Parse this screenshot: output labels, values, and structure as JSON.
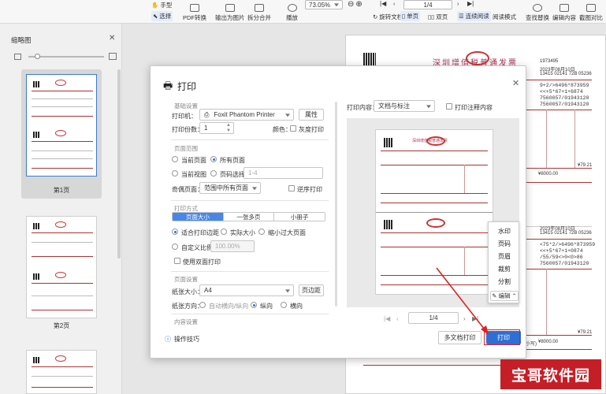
{
  "toolbar": {
    "hand_label": "手型",
    "select_label": "选择",
    "pdf_convert": "PDF转换",
    "export_image": "输出为图片",
    "split_merge": "拆分合并",
    "play": "播放",
    "zoom": "73.05%",
    "page_indicator": "1/4",
    "rotate": "旋转文档",
    "single_page": "单页",
    "double_page": "双页",
    "continuous": "连续阅读",
    "read_mode": "阅读模式",
    "find_replace": "查找替换",
    "edit_content": "编辑内容",
    "screenshot": "截图对比"
  },
  "sidebar": {
    "title": "缩略图",
    "pages": [
      "第1页",
      "第2页"
    ]
  },
  "dialog": {
    "title": "打印",
    "basic_settings": "基础设置",
    "printer_label": "打印机：",
    "printer_value": "Foxit Phantom Printer",
    "properties_button": "属性",
    "copies_label": "打印份数：",
    "copies_value": "1",
    "color_label": "颜色：",
    "grayscale_label": "灰度打印",
    "page_range": "页面范围",
    "current_page": "当前页面",
    "all_pages": "所有页面",
    "current_view": "当前视图",
    "page_select": "页码选择：",
    "page_select_placeholder": "1-4",
    "odd_even_label": "奇偶页面：",
    "odd_even_value": "范围中所有页面",
    "reverse_print": "逆序打印",
    "print_mode": "打印方式",
    "mode_tabs": [
      "页面大小",
      "一张多页",
      "小册子"
    ],
    "fit_margin": "适合打印边距",
    "actual_size": "实际大小",
    "shrink_large": "缩小过大页面",
    "custom_scale": "自定义比例",
    "custom_scale_value": "100.00%",
    "duplex": "使用双面打印",
    "page_setup": "页面设置",
    "paper_size_label": "纸张大小：",
    "paper_size_value": "A4",
    "page_margin_button": "页边距",
    "orientation_label": "纸张方向：",
    "orient_auto": "自动横向/纵向",
    "orient_portrait": "纵向",
    "orient_landscape": "横向",
    "content_settings": "内容设置",
    "tips": "操作技巧",
    "print_content_label": "打印内容：",
    "print_content_value": "文档与标注",
    "print_annotations": "打印注释内容",
    "preview_page": "1/4",
    "multi_doc_print": "多文档打印",
    "print_button": "打印"
  },
  "context_menu": [
    "水印",
    "页码",
    "页眉",
    "裁剪",
    "分割"
  ],
  "edit_label": "编辑",
  "document": {
    "invoice_title": "深圳增值税普通发票",
    "codes": [
      "1973495",
      "2023年08月10日",
      "13415 02141 72B 05236",
      "9+2/>6496*873959",
      "<<+5*67+1+6874",
      "<75*2/>6496*873959",
      "<<+5*67+1+0874",
      "/55/59<>0<0>86",
      "7560057/01943120",
      "7560057/01943120",
      "9+2/>6496*873959"
    ],
    "amount": "¥8000.00",
    "tax": "¥79.21",
    "footer_label": "(小写)"
  },
  "watermark": "宝哥软件园",
  "colors": {
    "accent": "#2d6fd6",
    "stamp": "#cc3333",
    "watermark_bg": "#c61e27"
  }
}
